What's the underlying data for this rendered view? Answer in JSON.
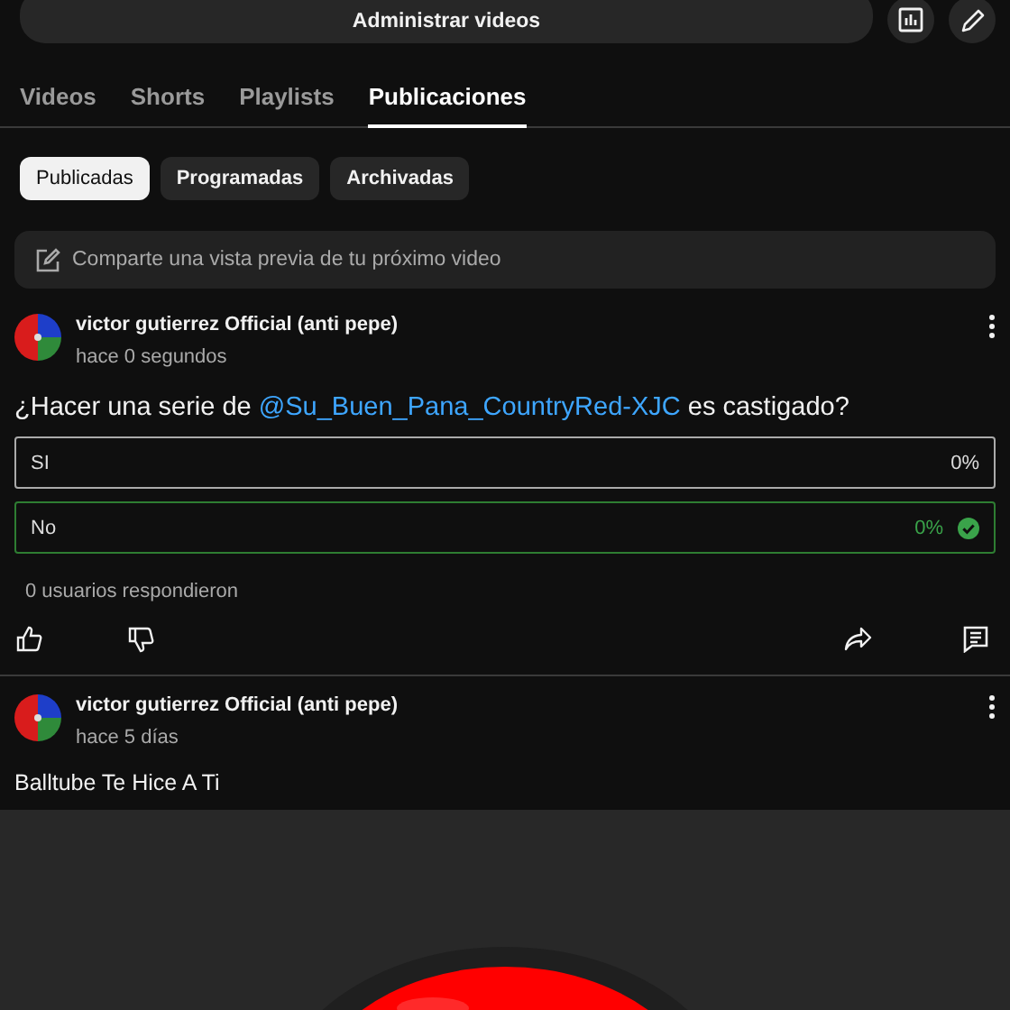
{
  "top_bar": {
    "manage_button": "Administrar videos"
  },
  "tabs": [
    {
      "label": "Videos",
      "selected": false
    },
    {
      "label": "Shorts",
      "selected": false
    },
    {
      "label": "Playlists",
      "selected": false
    },
    {
      "label": "Publicaciones",
      "selected": true
    }
  ],
  "filters": [
    {
      "label": "Publicadas",
      "selected": true
    },
    {
      "label": "Programadas",
      "selected": false
    },
    {
      "label": "Archivadas",
      "selected": false
    }
  ],
  "composer": {
    "placeholder": "Comparte una vista previa de tu próximo video"
  },
  "posts": [
    {
      "kind": "poll",
      "author": "victor gutierrez Official (anti pepe)",
      "time": "hace 0 segundos",
      "text_parts": [
        {
          "kind": "plain",
          "text": "¿Hacer una serie de "
        },
        {
          "kind": "mention",
          "text": "@Su_Buen_Pana_CountryRed-XJC"
        },
        {
          "kind": "plain",
          "text": " es castigado?"
        }
      ],
      "options": [
        {
          "label": "SI",
          "percent": "0%",
          "selected": false
        },
        {
          "label": "No",
          "percent": "0%",
          "selected": true
        }
      ],
      "respondents": "0 usuarios respondieron"
    },
    {
      "author": "victor gutierrez Official (anti pepe)",
      "time": "hace 5 días",
      "text_parts": [
        {
          "kind": "plain",
          "text": "Balltube Te Hice A Ti"
        }
      ]
    }
  ]
}
